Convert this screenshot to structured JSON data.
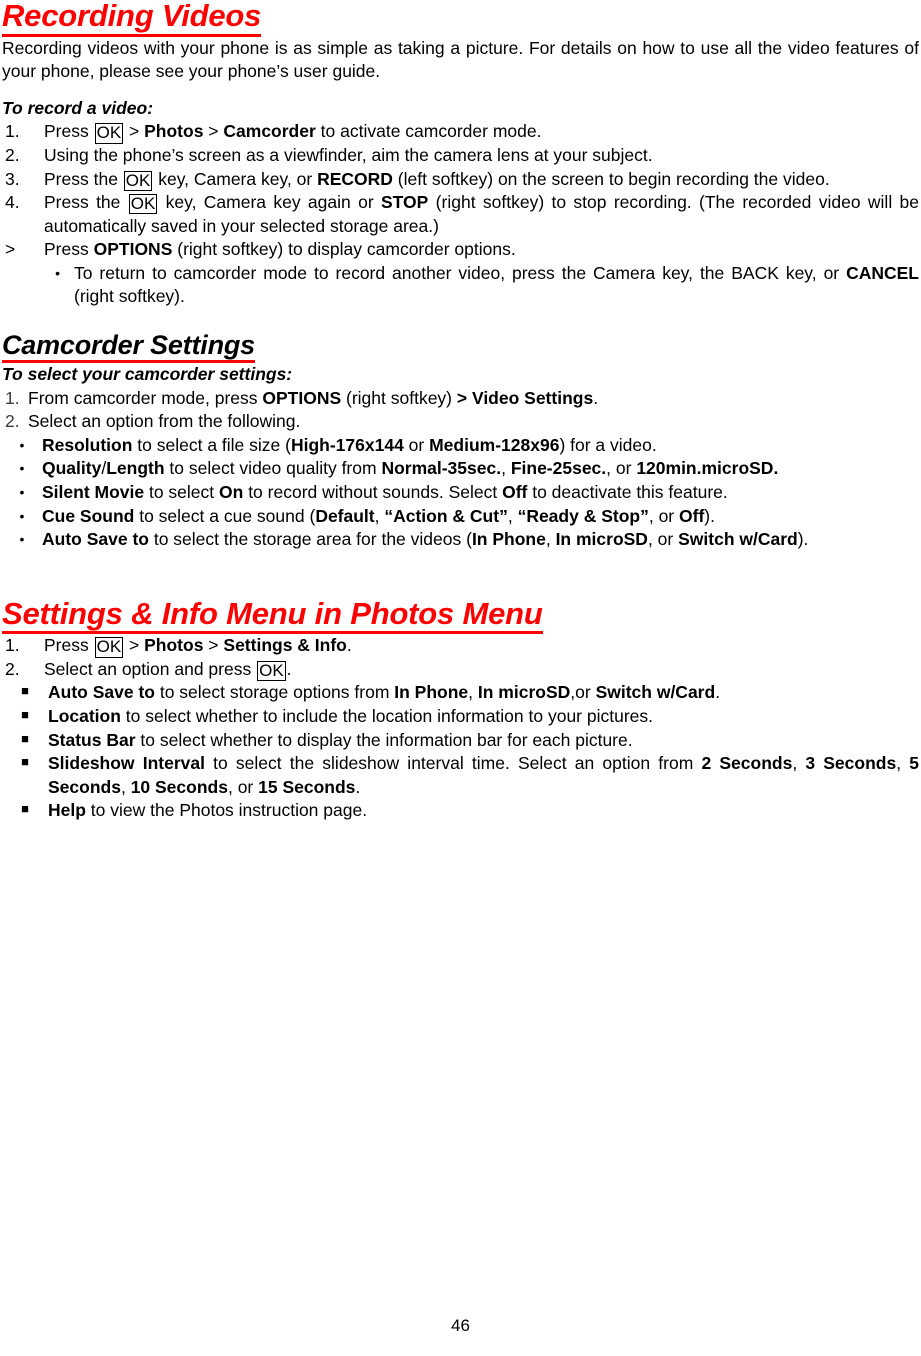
{
  "document": {
    "page_number": "46"
  },
  "section1": {
    "heading": "Recording Videos",
    "intro": "Recording videos with your phone is as simple as taking a picture. For details on how to use all the video features of your phone, please see your phone’s user guide.",
    "subhead": "To record a video:",
    "steps": [
      {
        "marker": "1.",
        "parts": [
          {
            "t": "Press ",
            "s": "normal"
          },
          {
            "t": "OK",
            "s": "key"
          },
          {
            "t": " > ",
            "s": "normal"
          },
          {
            "t": "Photos",
            "s": "bold"
          },
          {
            "t": " > ",
            "s": "normal"
          },
          {
            "t": "Camcorder",
            "s": "bold"
          },
          {
            "t": " to activate camcorder mode.",
            "s": "normal"
          }
        ]
      },
      {
        "marker": "2.",
        "parts": [
          {
            "t": "Using the phone’s screen as a viewfinder, aim the camera lens at your subject.",
            "s": "normal"
          }
        ]
      },
      {
        "marker": "3.",
        "parts": [
          {
            "t": "Press the ",
            "s": "normal"
          },
          {
            "t": "OK",
            "s": "key"
          },
          {
            "t": " key, Camera key, or ",
            "s": "normal"
          },
          {
            "t": "RECORD",
            "s": "bold"
          },
          {
            "t": " (left softkey) on the screen to begin recording the video.",
            "s": "normal"
          }
        ]
      },
      {
        "marker": "4.",
        "parts": [
          {
            "t": "Press the ",
            "s": "normal"
          },
          {
            "t": "OK",
            "s": "key"
          },
          {
            "t": " key, Camera key again or ",
            "s": "normal"
          },
          {
            "t": "STOP",
            "s": "bold"
          },
          {
            "t": " (right softkey) to stop recording. (The recorded video will be automatically saved in your selected storage area.)",
            "s": "normal"
          }
        ]
      },
      {
        "marker": ">",
        "parts": [
          {
            "t": "Press ",
            "s": "normal"
          },
          {
            "t": "OPTIONS",
            "s": "bold"
          },
          {
            "t": " (right softkey) to display camcorder options.",
            "s": "normal"
          }
        ]
      }
    ],
    "sub_bullet": {
      "marker": "•",
      "parts": [
        {
          "t": "To return to camcorder mode to record another video, press the Camera key, the BACK key, or ",
          "s": "normal"
        },
        {
          "t": "CANCEL",
          "s": "bold"
        },
        {
          "t": " (right softkey).",
          "s": "normal"
        }
      ]
    }
  },
  "section2": {
    "heading": "Camcorder Settings",
    "subhead": "To select your camcorder settings:",
    "steps": [
      {
        "marker": "1.",
        "parts": [
          {
            "t": "From camcorder mode, press ",
            "s": "normal"
          },
          {
            "t": "OPTIONS",
            "s": "bold"
          },
          {
            "t": " (right softkey) ",
            "s": "normal"
          },
          {
            "t": "> Video Settings",
            "s": "bold"
          },
          {
            "t": ".",
            "s": "normal"
          }
        ]
      },
      {
        "marker": "2.",
        "parts": [
          {
            "t": "Select an option from the following.",
            "s": "normal"
          }
        ]
      }
    ],
    "options": [
      {
        "marker": "•",
        "parts": [
          {
            "t": "Resolution",
            "s": "bold"
          },
          {
            "t": " to select a file size (",
            "s": "normal"
          },
          {
            "t": "High-176x144",
            "s": "bold"
          },
          {
            "t": " or ",
            "s": "normal"
          },
          {
            "t": "Medium-128x96",
            "s": "bold"
          },
          {
            "t": ") for a video.",
            "s": "normal"
          }
        ]
      },
      {
        "marker": "•",
        "parts": [
          {
            "t": "Quality",
            "s": "bold"
          },
          {
            "t": "/",
            "s": "normal"
          },
          {
            "t": "Length",
            "s": "bold"
          },
          {
            "t": " to select video quality from ",
            "s": "normal"
          },
          {
            "t": "Normal-35sec.",
            "s": "bold"
          },
          {
            "t": ", ",
            "s": "normal"
          },
          {
            "t": "Fine-25sec.",
            "s": "bold"
          },
          {
            "t": ", or ",
            "s": "normal"
          },
          {
            "t": "120min.microSD.",
            "s": "bold"
          }
        ]
      },
      {
        "marker": "•",
        "parts": [
          {
            "t": "Silent Movie",
            "s": "bold"
          },
          {
            "t": " to select ",
            "s": "normal"
          },
          {
            "t": "On",
            "s": "bold"
          },
          {
            "t": " to record without sounds. Select ",
            "s": "normal"
          },
          {
            "t": "Off",
            "s": "bold"
          },
          {
            "t": " to deactivate this feature.",
            "s": "normal"
          }
        ]
      },
      {
        "marker": "•",
        "parts": [
          {
            "t": "Cue Sound",
            "s": "bold"
          },
          {
            "t": " to select a cue sound (",
            "s": "normal"
          },
          {
            "t": "Default",
            "s": "bold"
          },
          {
            "t": ", ",
            "s": "normal"
          },
          {
            "t": "“Action & Cut”",
            "s": "bold"
          },
          {
            "t": ", ",
            "s": "normal"
          },
          {
            "t": "“Ready & Stop”",
            "s": "bold"
          },
          {
            "t": ", or ",
            "s": "normal"
          },
          {
            "t": "Off",
            "s": "bold"
          },
          {
            "t": ").",
            "s": "normal"
          }
        ]
      },
      {
        "marker": "•",
        "parts": [
          {
            "t": "Auto Save to",
            "s": "bold"
          },
          {
            "t": " to select the storage area for the videos (",
            "s": "normal"
          },
          {
            "t": "In Phone",
            "s": "bold"
          },
          {
            "t": ", ",
            "s": "normal"
          },
          {
            "t": "In microSD",
            "s": "bold"
          },
          {
            "t": ", or ",
            "s": "normal"
          },
          {
            "t": "Switch w/Card",
            "s": "bold"
          },
          {
            "t": ").",
            "s": "normal"
          }
        ]
      }
    ]
  },
  "section3": {
    "heading": "Settings & Info Menu in Photos Menu",
    "steps": [
      {
        "marker": "1.",
        "parts": [
          {
            "t": "Press ",
            "s": "normal"
          },
          {
            "t": "OK",
            "s": "key"
          },
          {
            "t": " > ",
            "s": "normal"
          },
          {
            "t": "Photos",
            "s": "bold"
          },
          {
            "t": " > ",
            "s": "normal"
          },
          {
            "t": "Settings & Info",
            "s": "bold"
          },
          {
            "t": ".",
            "s": "normal"
          }
        ]
      },
      {
        "marker": "2.",
        "parts": [
          {
            "t": "Select an option and press ",
            "s": "normal"
          },
          {
            "t": "OK",
            "s": "key"
          },
          {
            "t": ".",
            "s": "normal"
          }
        ]
      }
    ],
    "options": [
      {
        "marker": "■",
        "parts": [
          {
            "t": "Auto Save to",
            "s": "bold"
          },
          {
            "t": " to select storage options from ",
            "s": "normal"
          },
          {
            "t": "In Phone",
            "s": "bold"
          },
          {
            "t": ", ",
            "s": "normal"
          },
          {
            "t": "In microSD",
            "s": "bold"
          },
          {
            "t": ",or ",
            "s": "normal"
          },
          {
            "t": "Switch w/Card",
            "s": "bold"
          },
          {
            "t": ".",
            "s": "normal"
          }
        ]
      },
      {
        "marker": "■",
        "parts": [
          {
            "t": "Location",
            "s": "bold"
          },
          {
            "t": " to select whether to include the location information to your pictures.",
            "s": "normal"
          }
        ]
      },
      {
        "marker": "■",
        "parts": [
          {
            "t": "Status Bar",
            "s": "bold"
          },
          {
            "t": " to select whether to display the information bar for each picture.",
            "s": "normal"
          }
        ]
      },
      {
        "marker": "■",
        "parts": [
          {
            "t": "Slideshow Interval",
            "s": "bold"
          },
          {
            "t": " to select the slideshow interval time. Select an option from ",
            "s": "normal"
          },
          {
            "t": "2 Seconds",
            "s": "bold"
          },
          {
            "t": ", ",
            "s": "normal"
          },
          {
            "t": "3 Seconds",
            "s": "bold"
          },
          {
            "t": ", ",
            "s": "normal"
          },
          {
            "t": "5 Seconds",
            "s": "bold"
          },
          {
            "t": ", ",
            "s": "normal"
          },
          {
            "t": "10 Seconds",
            "s": "bold"
          },
          {
            "t": ", or ",
            "s": "normal"
          },
          {
            "t": "15 Seconds",
            "s": "bold"
          },
          {
            "t": ".",
            "s": "normal"
          }
        ]
      },
      {
        "marker": "■",
        "parts": [
          {
            "t": "Help",
            "s": "bold"
          },
          {
            "t": " to view the Photos instruction page.",
            "s": "normal"
          }
        ]
      }
    ]
  },
  "colors": {
    "heading_red": "#ff0000",
    "text_black": "#000000"
  }
}
